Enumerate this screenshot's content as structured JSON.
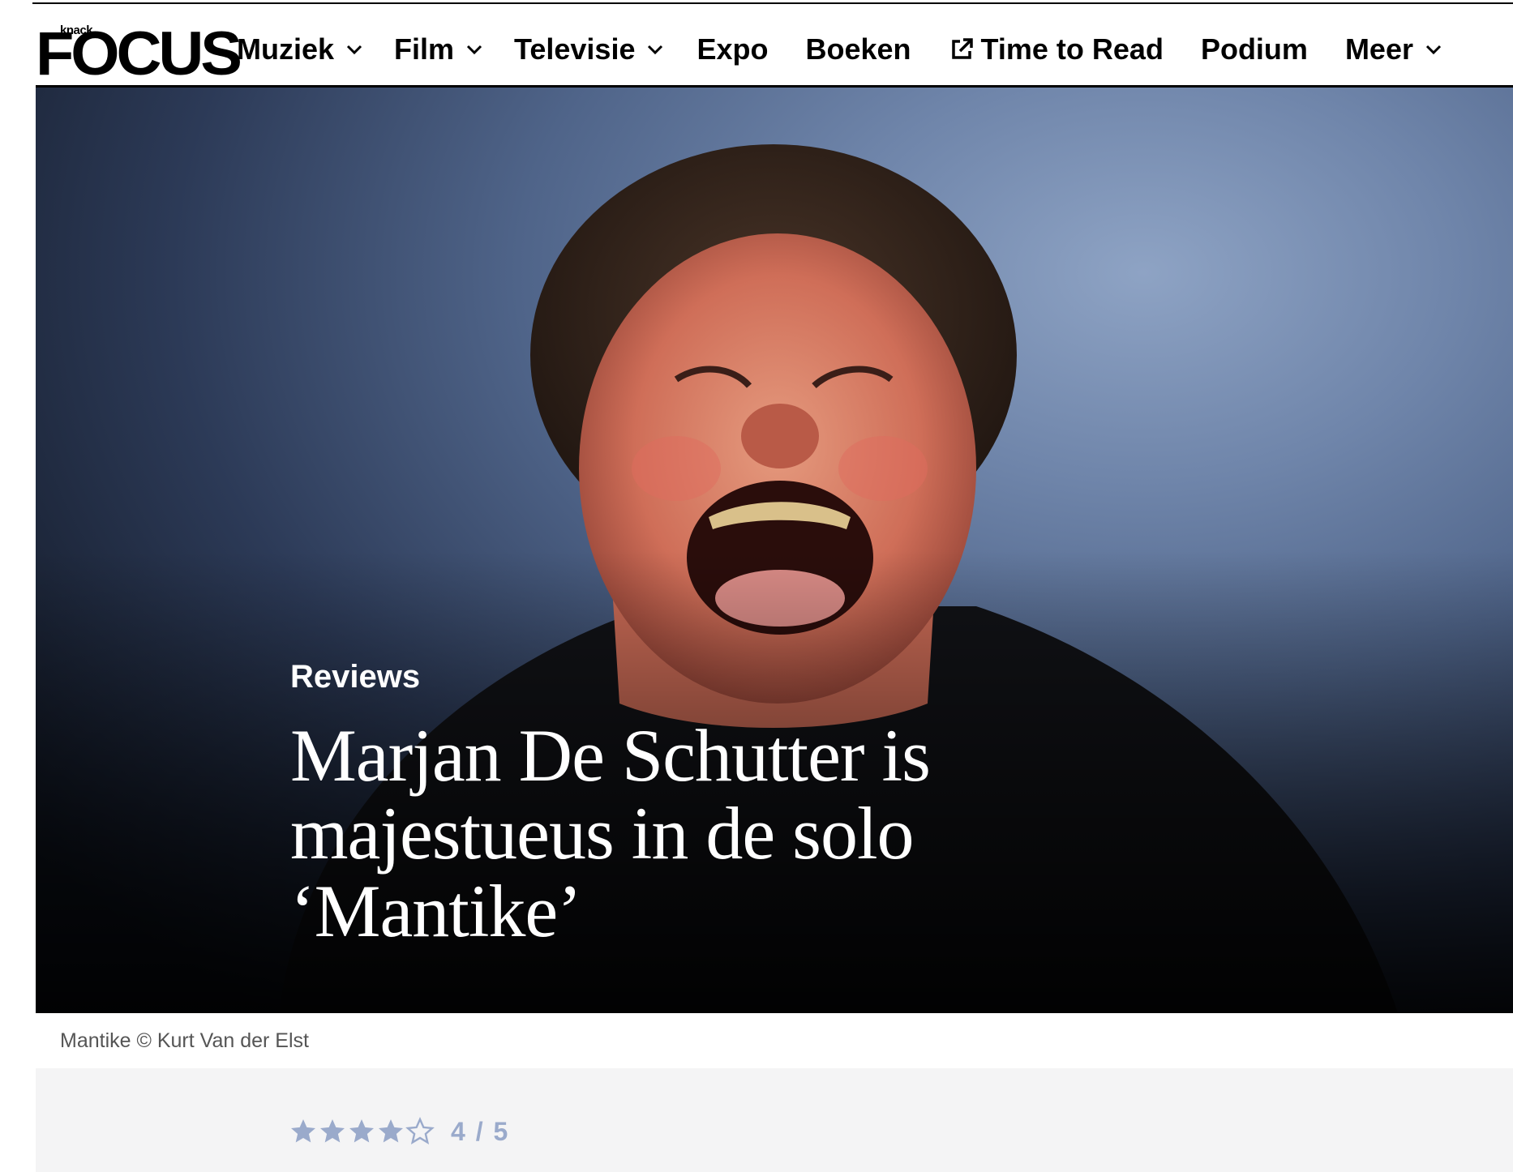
{
  "brand": {
    "small": "knack",
    "name": "Focus"
  },
  "nav": {
    "items": [
      {
        "label": "Muziek",
        "has_dropdown": true
      },
      {
        "label": "Film",
        "has_dropdown": true
      },
      {
        "label": "Televisie",
        "has_dropdown": true
      },
      {
        "label": "Expo",
        "has_dropdown": false
      },
      {
        "label": "Boeken",
        "has_dropdown": false
      },
      {
        "label": "Time to Read",
        "has_dropdown": false,
        "icon": "external-link-icon"
      },
      {
        "label": "Podium",
        "has_dropdown": false
      },
      {
        "label": "Meer",
        "has_dropdown": true
      }
    ]
  },
  "hero": {
    "category": "Reviews",
    "title": "Marjan De Schutter is majestueus in de solo ‘Mantike’"
  },
  "caption": "Mantike © Kurt Van der Elst",
  "rating": {
    "value": 4,
    "max": 5,
    "label": "4 / 5",
    "star_color": "#9aaacb"
  }
}
